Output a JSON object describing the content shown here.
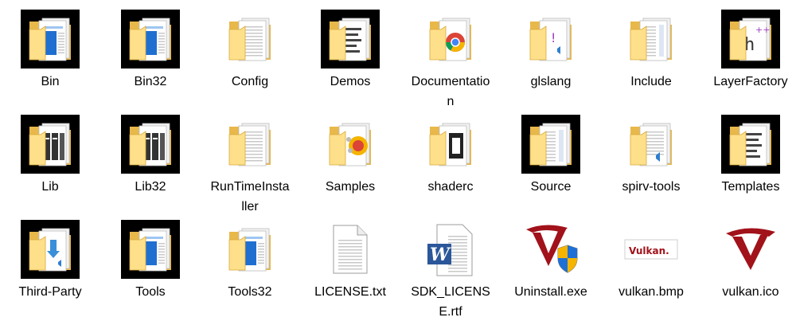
{
  "colors": {
    "folder_back": "#E8B84A",
    "folder_front": "#FFE08A",
    "folder_edge": "#D9A93C",
    "paper": "#FFFFFF",
    "paper_line": "#C8C8C8",
    "blue_doc": "#1F6FD1",
    "vulkan_red": "#A1121A",
    "word_blue": "#2B579A"
  },
  "items": [
    {
      "name": "Bin",
      "icon": "folder-exe-icon",
      "dark": true
    },
    {
      "name": "Bin32",
      "icon": "folder-exe-icon",
      "dark": true
    },
    {
      "name": "Config",
      "icon": "folder-doc-icon",
      "dark": false
    },
    {
      "name": "Demos",
      "icon": "folder-text-icon",
      "dark": true
    },
    {
      "name": "Documentation",
      "icon": "folder-chrome-icon",
      "dark": false
    },
    {
      "name": "glslang",
      "icon": "folder-code-icon",
      "dark": false
    },
    {
      "name": "Include",
      "icon": "folder-header-icon",
      "dark": false
    },
    {
      "name": "LayerFactory",
      "icon": "folder-cpp-icon",
      "dark": true
    },
    {
      "name": "Lib",
      "icon": "folder-library-icon",
      "dark": true
    },
    {
      "name": "Lib32",
      "icon": "folder-library-icon",
      "dark": true
    },
    {
      "name": "RunTimeInstaller",
      "icon": "folder-plain-icon",
      "dark": false
    },
    {
      "name": "Samples",
      "icon": "folder-samples-icon",
      "dark": false
    },
    {
      "name": "shaderc",
      "icon": "folder-dark-doc-icon",
      "dark": false
    },
    {
      "name": "Source",
      "icon": "folder-header-icon",
      "dark": true
    },
    {
      "name": "spirv-tools",
      "icon": "folder-vscode-icon",
      "dark": false
    },
    {
      "name": "Templates",
      "icon": "folder-text-icon",
      "dark": true
    },
    {
      "name": "Third-Party",
      "icon": "folder-download-icon",
      "dark": true
    },
    {
      "name": "Tools",
      "icon": "folder-exe-icon",
      "dark": true
    },
    {
      "name": "Tools32",
      "icon": "folder-exe-icon",
      "dark": false
    },
    {
      "name": "LICENSE.txt",
      "icon": "text-file-icon",
      "dark": false
    },
    {
      "name": "SDK_LICENSE.rtf",
      "icon": "word-file-icon",
      "dark": false
    },
    {
      "name": "Uninstall.exe",
      "icon": "vulkan-uninstall-icon",
      "dark": false
    },
    {
      "name": "vulkan.bmp",
      "icon": "vulkan-bmp-icon",
      "dark": false
    },
    {
      "name": "vulkan.ico",
      "icon": "vulkan-logo-icon",
      "dark": false
    }
  ]
}
